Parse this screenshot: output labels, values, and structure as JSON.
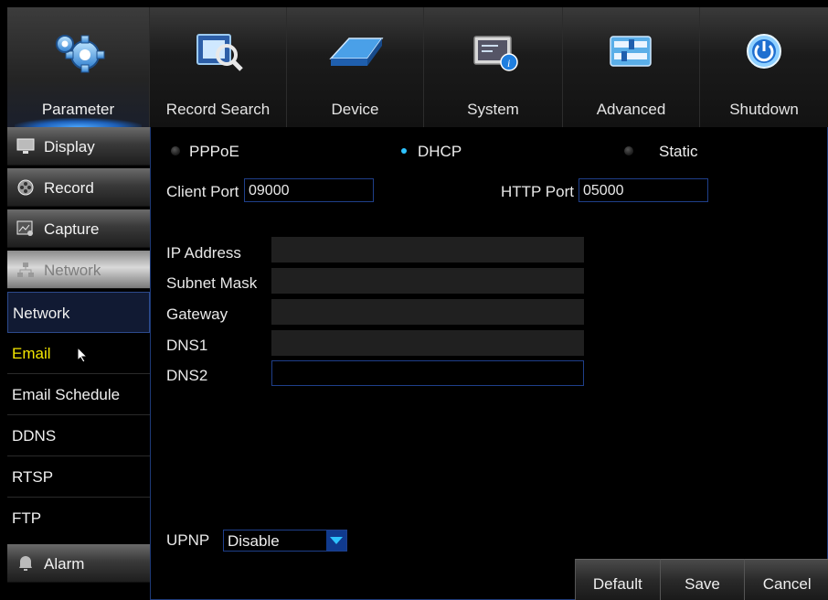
{
  "tabs": [
    {
      "label": "Parameter",
      "icon": "gears-icon",
      "active": true
    },
    {
      "label": "Record Search",
      "icon": "film-search-icon",
      "active": false
    },
    {
      "label": "Device",
      "icon": "hard-drive-icon",
      "active": false
    },
    {
      "label": "System",
      "icon": "system-info-icon",
      "active": false
    },
    {
      "label": "Advanced",
      "icon": "sliders-icon",
      "active": false
    },
    {
      "label": "Shutdown",
      "icon": "power-icon",
      "active": false
    }
  ],
  "sidebar": {
    "categories": [
      {
        "label": "Display",
        "icon": "monitor-icon"
      },
      {
        "label": "Record",
        "icon": "film-reel-icon"
      },
      {
        "label": "Capture",
        "icon": "capture-icon"
      },
      {
        "label": "Network",
        "icon": "network-icon"
      }
    ],
    "items": [
      {
        "label": "Network"
      },
      {
        "label": "Email"
      },
      {
        "label": "Email Schedule"
      },
      {
        "label": "DDNS"
      },
      {
        "label": "RTSP"
      },
      {
        "label": "FTP"
      }
    ],
    "bottom_category": {
      "label": "Alarm",
      "icon": "alarm-bell-icon"
    }
  },
  "network": {
    "modes": [
      "PPPoE",
      "DHCP",
      "Static"
    ],
    "selected_mode": "DHCP",
    "client_port_label": "Client Port",
    "client_port": "09000",
    "http_port_label": "HTTP Port",
    "http_port": "05000",
    "ip_address_label": "IP Address",
    "subnet_mask_label": "Subnet Mask",
    "gateway_label": "Gateway",
    "dns1_label": "DNS1",
    "dns2_label": "DNS2",
    "upnp_label": "UPNP",
    "upnp_value": "Disable"
  },
  "buttons": {
    "default": "Default",
    "save": "Save",
    "cancel": "Cancel"
  },
  "colors": {
    "accent_blue": "#2ec3ff",
    "border_blue": "#1f3f8a",
    "hover_yellow": "#f3e600"
  }
}
